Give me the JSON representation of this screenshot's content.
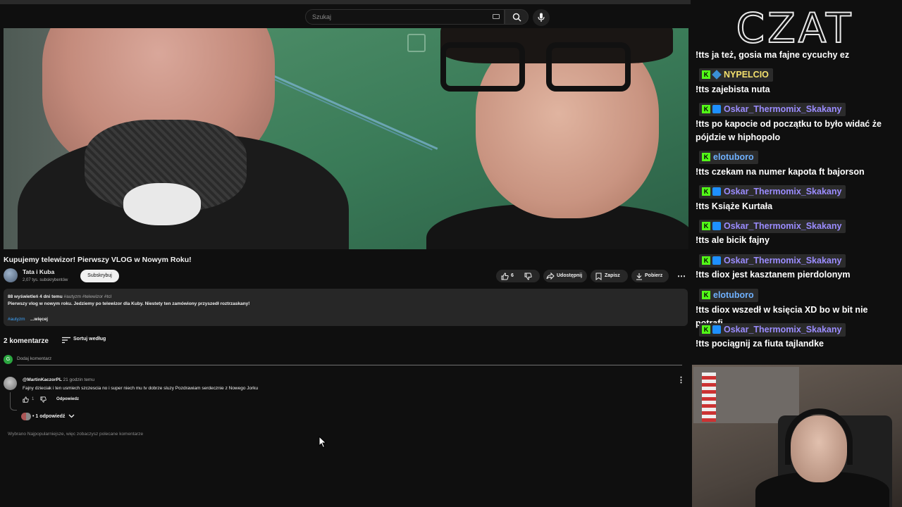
{
  "youtube": {
    "search_placeholder": "Szukaj",
    "video_title": "Kupujemy telewizor! Pierwszy VLOG w Nowym Roku!",
    "channel": {
      "name": "Tata i Kuba",
      "subscribers": "2,07 tys. subskrybentów",
      "subscribe_label": "Subskrybuj"
    },
    "actions": {
      "likes": "6",
      "share": "Udostępnij",
      "save": "Zapisz",
      "download": "Pobierz"
    },
    "description": {
      "views_time": "88 wyświetleń  4 dni temu",
      "hashtags": "#autyzm #telewizor #tcl",
      "text": "Pierwszy vlog w nowym roku. Jedziemy po telewizor dla Kuby. Niestety ten zamówiony przyszedł roztrzaskany!",
      "tag_line": "#autyzm",
      "more": "...więcej"
    },
    "comments": {
      "count_label": "2 komentarze",
      "sort_label": "Sortuj według",
      "my_avatar_letter": "G",
      "add_placeholder": "Dodaj komentarz",
      "items": [
        {
          "author": "@MartinKaczorPL",
          "time": "21 godzin temu",
          "text": "Fajny dzieciak i ten usmiech szczescia no i super  niech mu tv dobrze sluzy  Pozdrawiam serdecznie z Nowego Jorku",
          "likes": "1",
          "reply_label": "Odpowiedz",
          "replies_label": "• 1 odpowiedź"
        }
      ],
      "recommendation_note": "Wybrano Najpopularniejsze, więc zobaczysz polecane komentarze"
    }
  },
  "chat": {
    "title": "CZAT",
    "messages": [
      {
        "text": "!tts ja też, gosia ma fajne cycuchy ez"
      },
      {
        "user": "NYPELCIO",
        "user_color": "#f4e06d",
        "badge": "gem",
        "text": "!tts zajebista nuta"
      },
      {
        "user": "Oskar_Thermomix_Skakany",
        "user_color": "#9b8cff",
        "badge": "blue",
        "text": "!tts po kapocie od początku to było widać że pójdzie w hiphopolo"
      },
      {
        "user": "elotuboro",
        "user_color": "#6fb1ff",
        "badge": "none",
        "text": "!tts czekam na numer kapota ft bajorson"
      },
      {
        "user": "Oskar_Thermomix_Skakany",
        "user_color": "#9b8cff",
        "badge": "blue",
        "text": "!tts Książe Kurtała"
      },
      {
        "user": "Oskar_Thermomix_Skakany",
        "user_color": "#9b8cff",
        "badge": "blue",
        "text": "!tts ale bicik fajny"
      },
      {
        "user": "Oskar_Thermomix_Skakany",
        "user_color": "#9b8cff",
        "badge": "blue",
        "text": "!tts diox jest kasztanem pierdolonym"
      },
      {
        "user": "elotuboro",
        "user_color": "#6fb1ff",
        "badge": "none",
        "text": "!tts diox wszedł w księcia XD bo w bit nie potrafi"
      },
      {
        "user": "Oskar_Thermomix_Skakany",
        "user_color": "#9b8cff",
        "badge": "blue",
        "text": "!tts pociągnij za fiuta tajlandke"
      }
    ]
  },
  "colors": {
    "accent_link": "#3ea6ff",
    "kick_green": "#53fc18"
  }
}
